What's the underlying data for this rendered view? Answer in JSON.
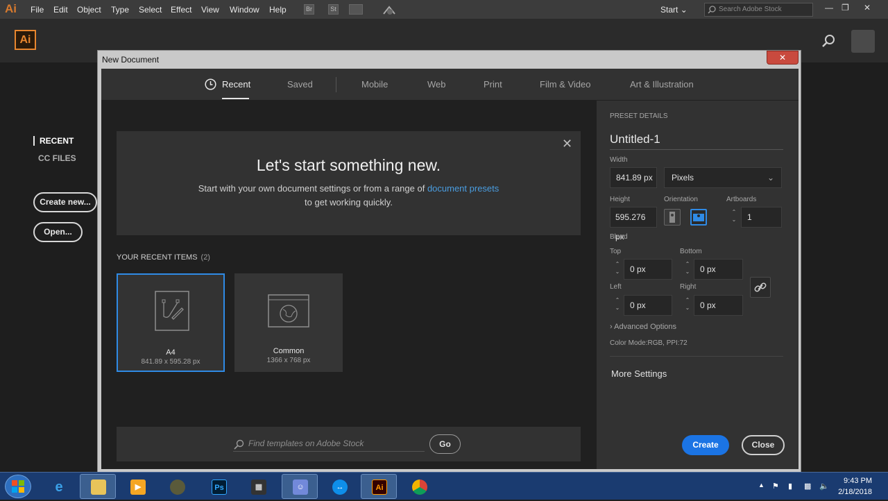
{
  "app": {
    "logo_mini": "Ai",
    "menus": [
      "File",
      "Edit",
      "Object",
      "Type",
      "Select",
      "Effect",
      "View",
      "Window",
      "Help"
    ],
    "toolbar_icons": [
      "Br",
      "St"
    ],
    "workspace": "Start",
    "stock_search_placeholder": "Search Adobe Stock",
    "logo": "Ai"
  },
  "home": {
    "nav_recent": "RECENT",
    "nav_cc": "CC FILES",
    "create_new": "Create new...",
    "open": "Open..."
  },
  "dialog": {
    "title": "New Document",
    "tabs": [
      "Recent",
      "Saved",
      "Mobile",
      "Web",
      "Print",
      "Film & Video",
      "Art & Illustration"
    ],
    "hero": {
      "title": "Let's start something new.",
      "sub_before": "Start with your own document settings or from a range of ",
      "sub_link": "document presets",
      "sub_after": "to get working quickly."
    },
    "recent_header": "YOUR RECENT ITEMS",
    "recent_count": "(2)",
    "recent_items": [
      {
        "name": "A4",
        "size": "841.89 x 595.28 px"
      },
      {
        "name": "Common",
        "size": "1366 x 768 px"
      }
    ],
    "stock_placeholder": "Find templates on Adobe Stock",
    "stock_go": "Go"
  },
  "preset": {
    "header": "PRESET DETAILS",
    "name": "Untitled-1",
    "width_label": "Width",
    "width": "841.89 px",
    "units": "Pixels",
    "height_label": "Height",
    "height": "595.276 px",
    "orientation_label": "Orientation",
    "artboards_label": "Artboards",
    "artboards": "1",
    "bleed_label": "Bleed",
    "top_label": "Top",
    "top": "0 px",
    "bottom_label": "Bottom",
    "bottom": "0 px",
    "left_label": "Left",
    "left": "0 px",
    "right_label": "Right",
    "right": "0 px",
    "advanced": "Advanced Options",
    "color_mode": "Color Mode:RGB, PPI:72",
    "more_settings": "More Settings",
    "create": "Create",
    "close": "Close"
  },
  "taskbar": {
    "time": "9:43 PM",
    "date": "2/18/2018",
    "apps": [
      "internet-explorer",
      "file-explorer",
      "media-player",
      "grenade-game",
      "photoshop",
      "video-editor",
      "discord",
      "teamviewer",
      "illustrator",
      "chrome"
    ]
  },
  "colors": {
    "accent": "#1b74e4",
    "ai_orange": "#e8862e",
    "link": "#4a9de0"
  }
}
